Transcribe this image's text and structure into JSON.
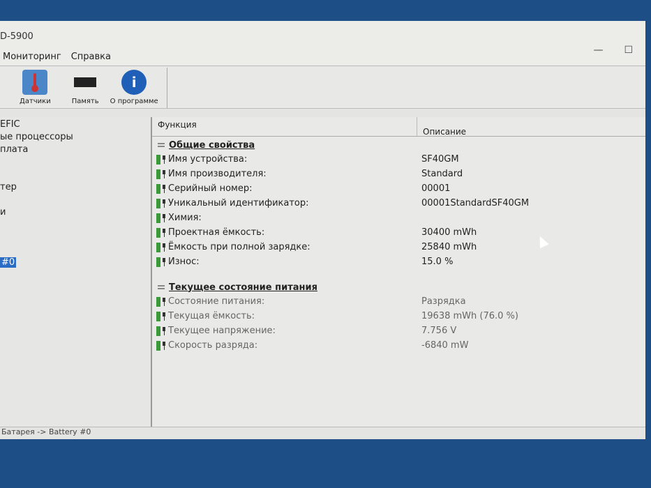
{
  "window": {
    "title": "D-5900",
    "minimize": "—",
    "maximize": "☐"
  },
  "menu": [
    "Мониторинг",
    "Справка"
  ],
  "toolbar": [
    {
      "label": "Датчики",
      "icon": "thermometer-icon"
    },
    {
      "label": "Память",
      "icon": "memory-icon"
    },
    {
      "label": "О программе",
      "icon": "info-icon"
    }
  ],
  "tree": [
    "EFIC",
    "ые процессоры",
    "плата",
    "",
    "",
    "тер",
    "",
    "и",
    "",
    "",
    "",
    "#0"
  ],
  "detail": {
    "col_function": "Функция",
    "col_description": "Описание",
    "groups": [
      {
        "title": "Общие свойства",
        "rows": [
          {
            "label": "Имя устройства:",
            "value": "SF40GM"
          },
          {
            "label": "Имя производителя:",
            "value": "Standard"
          },
          {
            "label": "Серийный номер:",
            "value": "00001"
          },
          {
            "label": "Уникальный идентификатор:",
            "value": "00001StandardSF40GM"
          },
          {
            "label": "Химия:",
            "value": ""
          },
          {
            "label": "Проектная ёмкость:",
            "value": "30400 mWh"
          },
          {
            "label": "Ёмкость при полной зарядке:",
            "value": "25840 mWh"
          },
          {
            "label": "Износ:",
            "value": "15.0 %"
          }
        ]
      },
      {
        "title": "Текущее состояние питания",
        "rows": [
          {
            "label": "Состояние питания:",
            "value": "Разрядка"
          },
          {
            "label": "Текущая ёмкость:",
            "value": "19638 mWh (76.0 %)"
          },
          {
            "label": "Текущее напряжение:",
            "value": "7.756 V"
          },
          {
            "label": "Скорость разряда:",
            "value": "-6840 mW"
          }
        ]
      }
    ]
  },
  "status": "Батарея -> Battery #0"
}
